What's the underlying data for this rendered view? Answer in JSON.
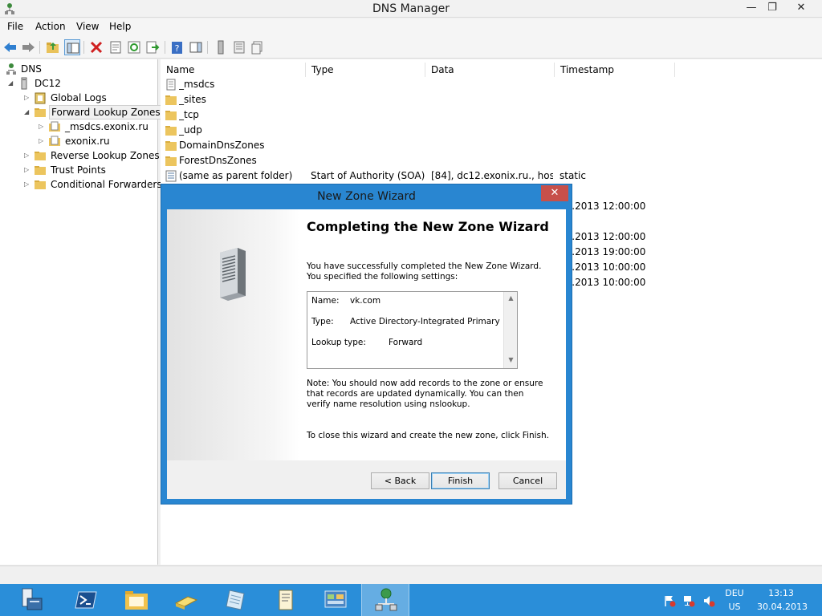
{
  "window": {
    "title": "DNS Manager",
    "min_glyph": "—",
    "max_glyph": "❐",
    "close_glyph": "✕"
  },
  "menu": [
    "File",
    "Action",
    "View",
    "Help"
  ],
  "toolbar": {
    "icons": [
      "back-arrow-icon",
      "forward-arrow-icon",
      "up-folder-icon",
      "show-hide-tree-icon",
      "delete-icon",
      "properties-icon",
      "refresh-icon",
      "export-list-icon",
      "help-icon",
      "show-action-pane-icon",
      "server-icon",
      "records-icon",
      "zone-icon"
    ]
  },
  "tree": {
    "root": "DNS",
    "server": "DC12",
    "global_logs": "Global Logs",
    "forward_zones": "Forward Lookup Zones",
    "zone_msdcs": "_msdcs.exonix.ru",
    "zone_exonix": "exonix.ru",
    "reverse_zones": "Reverse Lookup Zones",
    "trust_points": "Trust Points",
    "conditional_forwarders": "Conditional Forwarders"
  },
  "list": {
    "columns": [
      "Name",
      "Type",
      "Data",
      "Timestamp"
    ],
    "rows": [
      {
        "name": "_msdcs",
        "type": "",
        "data": "",
        "timestamp": "",
        "icon": "zone-folder"
      },
      {
        "name": "_sites",
        "type": "",
        "data": "",
        "timestamp": "",
        "icon": "folder"
      },
      {
        "name": "_tcp",
        "type": "",
        "data": "",
        "timestamp": "",
        "icon": "folder"
      },
      {
        "name": "_udp",
        "type": "",
        "data": "",
        "timestamp": "",
        "icon": "folder"
      },
      {
        "name": "DomainDnsZones",
        "type": "",
        "data": "",
        "timestamp": "",
        "icon": "folder"
      },
      {
        "name": "ForestDnsZones",
        "type": "",
        "data": "",
        "timestamp": "",
        "icon": "folder"
      },
      {
        "name": "(same as parent folder)",
        "type": "Start of Authority (SOA)",
        "data": "[84], dc12.exonix.ru., host...",
        "timestamp": "static",
        "icon": "record"
      },
      {
        "name": "",
        "type": "",
        "data": "",
        "timestamp": "tic",
        "icon": ""
      },
      {
        "name": "",
        "type": "",
        "data": "",
        "timestamp": "04.2013 12:00:00",
        "icon": ""
      },
      {
        "name": "",
        "type": "",
        "data": "",
        "timestamp": "tic",
        "icon": ""
      },
      {
        "name": "",
        "type": "",
        "data": "",
        "timestamp": "03.2013 12:00:00",
        "icon": ""
      },
      {
        "name": "",
        "type": "",
        "data": "",
        "timestamp": "04.2013 19:00:00",
        "icon": ""
      },
      {
        "name": "",
        "type": "",
        "data": "",
        "timestamp": "04.2013 10:00:00",
        "icon": ""
      },
      {
        "name": "",
        "type": "",
        "data": "",
        "timestamp": "04.2013 10:00:00",
        "icon": ""
      }
    ]
  },
  "wizard": {
    "title": "New Zone Wizard",
    "close_glyph": "✕",
    "heading": "Completing the New Zone Wizard",
    "intro": "You have successfully completed the New Zone Wizard. You specified the following settings:",
    "settings": {
      "name_label": "Name:",
      "name_value": "vk.com",
      "type_label": "Type:",
      "type_value": "Active Directory-Integrated Primary",
      "lookup_label": "Lookup type:",
      "lookup_value": "Forward"
    },
    "note": "Note: You should now add records to the zone or ensure that records are updated dynamically. You can then verify name resolution using nslookup.",
    "close_instruction": "To close this wizard and create the new zone, click Finish.",
    "back_button": "< Back",
    "finish_button": "Finish",
    "cancel_button": "Cancel"
  },
  "taskbar": {
    "apps": [
      "server-manager-icon",
      "powershell-icon",
      "file-explorer-icon",
      "books-icon",
      "notepad-icon",
      "scroll-icon",
      "control-panel-icon",
      "dns-manager-icon"
    ],
    "tray": {
      "language_top": "DEU",
      "language_bottom": "US",
      "time": "13:13",
      "date": "30.04.2013"
    }
  },
  "colors": {
    "taskbar": "#2a8ed9",
    "wizard_frame": "#2986d1",
    "close_button": "#c7504a"
  }
}
